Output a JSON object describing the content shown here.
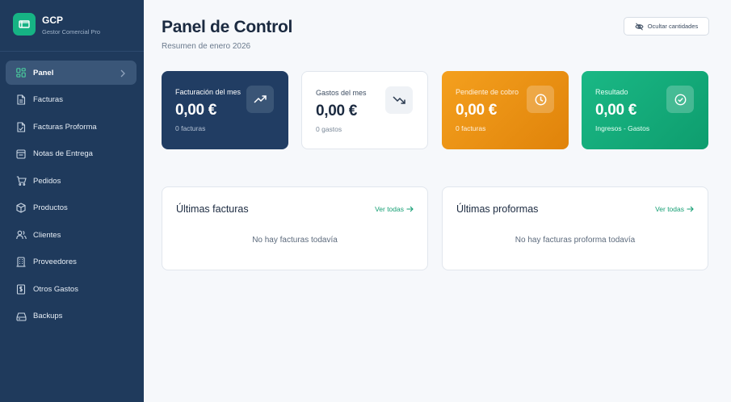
{
  "brand": {
    "title": "GCP",
    "subtitle": "Gestor Comercial Pro"
  },
  "sidebar": {
    "items": [
      {
        "label": "Panel",
        "icon": "dashboard-icon",
        "active": true
      },
      {
        "label": "Facturas",
        "icon": "invoice-icon"
      },
      {
        "label": "Facturas Proforma",
        "icon": "proforma-icon"
      },
      {
        "label": "Notas de Entrega",
        "icon": "delivery-note-icon"
      },
      {
        "label": "Pedidos",
        "icon": "cart-icon"
      },
      {
        "label": "Productos",
        "icon": "box-icon"
      },
      {
        "label": "Clientes",
        "icon": "users-icon"
      },
      {
        "label": "Proveedores",
        "icon": "building-icon"
      },
      {
        "label": "Otros Gastos",
        "icon": "receipt-icon"
      },
      {
        "label": "Backups",
        "icon": "database-icon"
      }
    ]
  },
  "header": {
    "title": "Panel de Control",
    "subtitle": "Resumen de enero 2026",
    "hide_button": "Ocultar cantidades"
  },
  "stats": [
    {
      "label": "Facturación del mes",
      "value": "0,00 €",
      "sub": "0 facturas",
      "icon": "trending-up-icon"
    },
    {
      "label": "Gastos del mes",
      "value": "0,00 €",
      "sub": "0 gastos",
      "icon": "trending-down-icon"
    },
    {
      "label": "Pendiente de cobro",
      "value": "0,00 €",
      "sub": "0 facturas",
      "icon": "clock-icon"
    },
    {
      "label": "Resultado",
      "value": "0,00 €",
      "sub": "Ingresos - Gastos",
      "icon": "check-circle-icon"
    }
  ],
  "panels": [
    {
      "title": "Últimas facturas",
      "link": "Ver todas",
      "empty": "No hay facturas todavía"
    },
    {
      "title": "Últimas proformas",
      "link": "Ver todas",
      "empty": "No hay facturas proforma todavía"
    }
  ],
  "colors": {
    "sidebar_bg": "#1f3a5c",
    "brand_green": "#16b384",
    "card_navy": "#213d63",
    "card_orange": "#f4a01e",
    "card_green": "#1ab885",
    "link_green": "#169f74"
  }
}
